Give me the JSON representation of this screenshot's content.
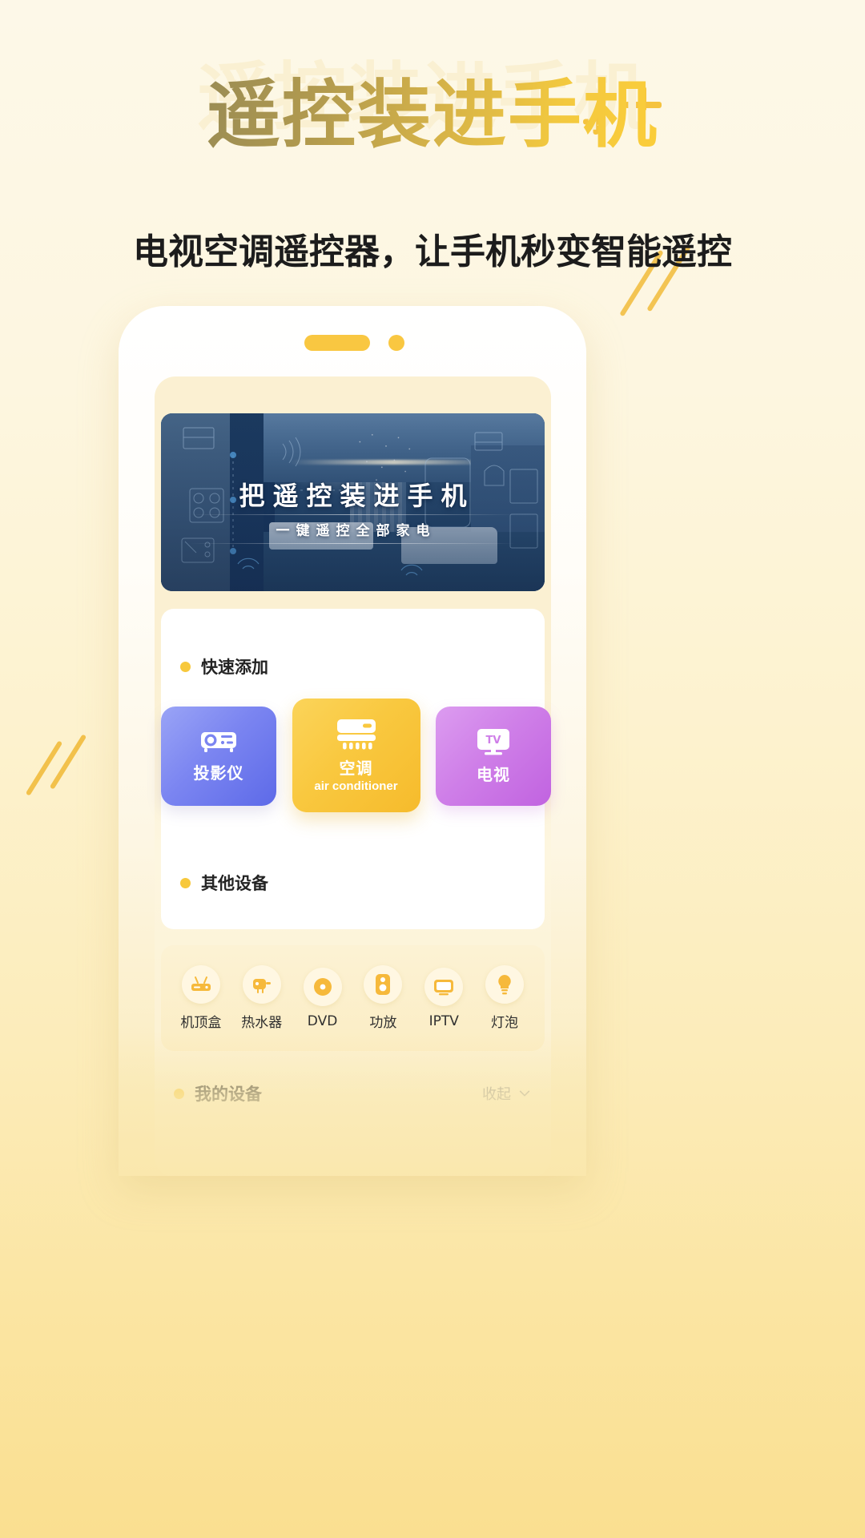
{
  "poster": {
    "headline": "遥控装进手机",
    "subtitle": "电视空调遥控器，让手机秒变智能遥控",
    "accent_color": "#f7c83c",
    "bg_top_color": "#fdf8e8",
    "bg_bottom_color": "#fadf90",
    "decor": {
      "plus_large": "plus-icon",
      "plus_small": "plus-icon",
      "slashes_right": "diagonal-slashes-icon",
      "slashes_left": "diagonal-slashes-icon"
    }
  },
  "phone": {
    "status": {
      "pill": "speaker-pill",
      "dot": "camera-dot"
    },
    "banner": {
      "title": "把遥控装进手机",
      "subtitle": "一键遥控全部家电",
      "image_alt": "smart-home-living-room"
    },
    "quick_add": {
      "section_title": "快速添加",
      "cards": [
        {
          "id": "projector",
          "icon": "projector-icon",
          "cn": "投影仪",
          "en": "",
          "color": "#6d79ee"
        },
        {
          "id": "air-conditioner",
          "icon": "air-conditioner-icon",
          "cn": "空调",
          "en": "air conditioner",
          "color": "#f9c83f"
        },
        {
          "id": "tv",
          "icon": "tv-icon",
          "cn": "电视",
          "en": "",
          "color": "#cf7fe8"
        }
      ]
    },
    "other_devices": {
      "section_title": "其他设备",
      "items": [
        {
          "id": "set-top-box",
          "icon": "set-top-box-icon",
          "label": "机顶盒"
        },
        {
          "id": "water-heater",
          "icon": "water-heater-icon",
          "label": "热水器"
        },
        {
          "id": "dvd",
          "icon": "dvd-disc-icon",
          "label": "DVD"
        },
        {
          "id": "amplifier",
          "icon": "amplifier-icon",
          "label": "功放"
        },
        {
          "id": "iptv",
          "icon": "iptv-icon",
          "label": "IPTV"
        },
        {
          "id": "light-bulb",
          "icon": "light-bulb-icon",
          "label": "灯泡"
        }
      ]
    },
    "my_devices": {
      "title": "我的设备",
      "collapse_label": "收起",
      "chevron": "chevron-down-icon"
    }
  }
}
